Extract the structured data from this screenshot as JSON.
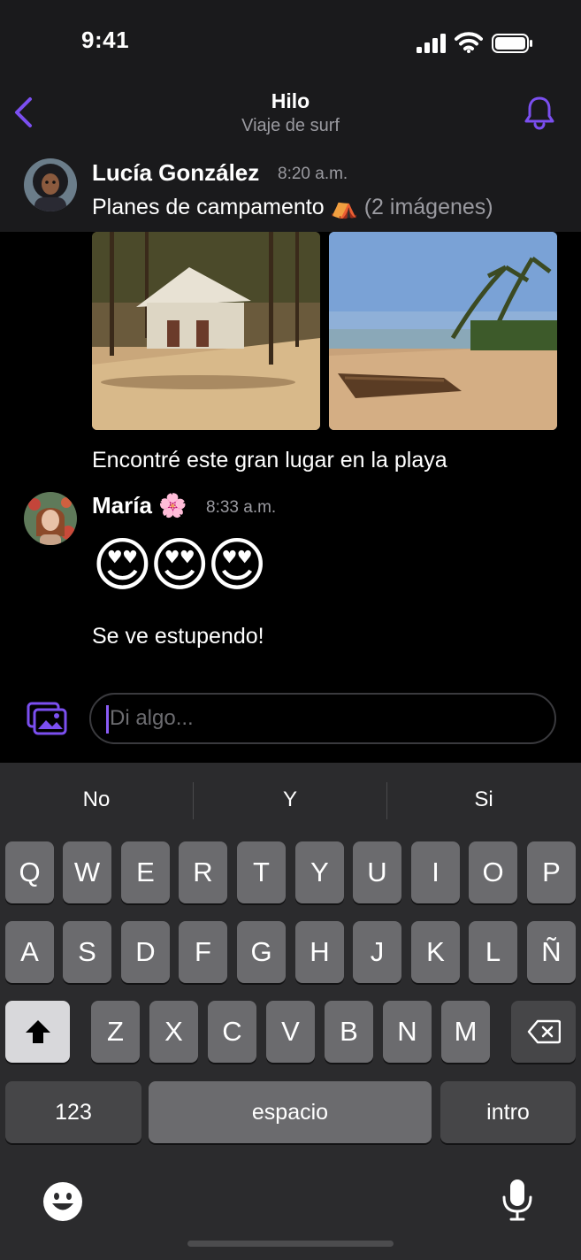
{
  "status_bar": {
    "time": "9:41"
  },
  "header": {
    "title": "Hilo",
    "subtitle": "Viaje de surf"
  },
  "parent_message": {
    "author": "Lucía González",
    "time": "8:20 a.m.",
    "text": "Planes de campamento",
    "emoji": "⛺",
    "attachment_note": "(2 imágenes)"
  },
  "thread": {
    "caption": "Encontré este gran lugar en la playa",
    "reply": {
      "author": "María",
      "author_emoji": "🌸",
      "time": "8:33 a.m.",
      "emojis": "😍😍😍",
      "text": "Se ve estupendo!"
    }
  },
  "composer": {
    "placeholder": "Di algo..."
  },
  "keyboard": {
    "suggestions": [
      "No",
      "Y",
      "Si"
    ],
    "row1": [
      "Q",
      "W",
      "E",
      "R",
      "T",
      "Y",
      "U",
      "I",
      "O",
      "P"
    ],
    "row2": [
      "A",
      "S",
      "D",
      "F",
      "G",
      "H",
      "J",
      "K",
      "L",
      "Ñ"
    ],
    "row3": [
      "Z",
      "X",
      "C",
      "V",
      "B",
      "N",
      "M"
    ],
    "numbers_label": "123",
    "space_label": "espacio",
    "return_label": "intro"
  },
  "colors": {
    "accent": "#7b4ff0",
    "keyboard_bg": "#2b2b2d",
    "key_bg": "#6b6b6e"
  }
}
